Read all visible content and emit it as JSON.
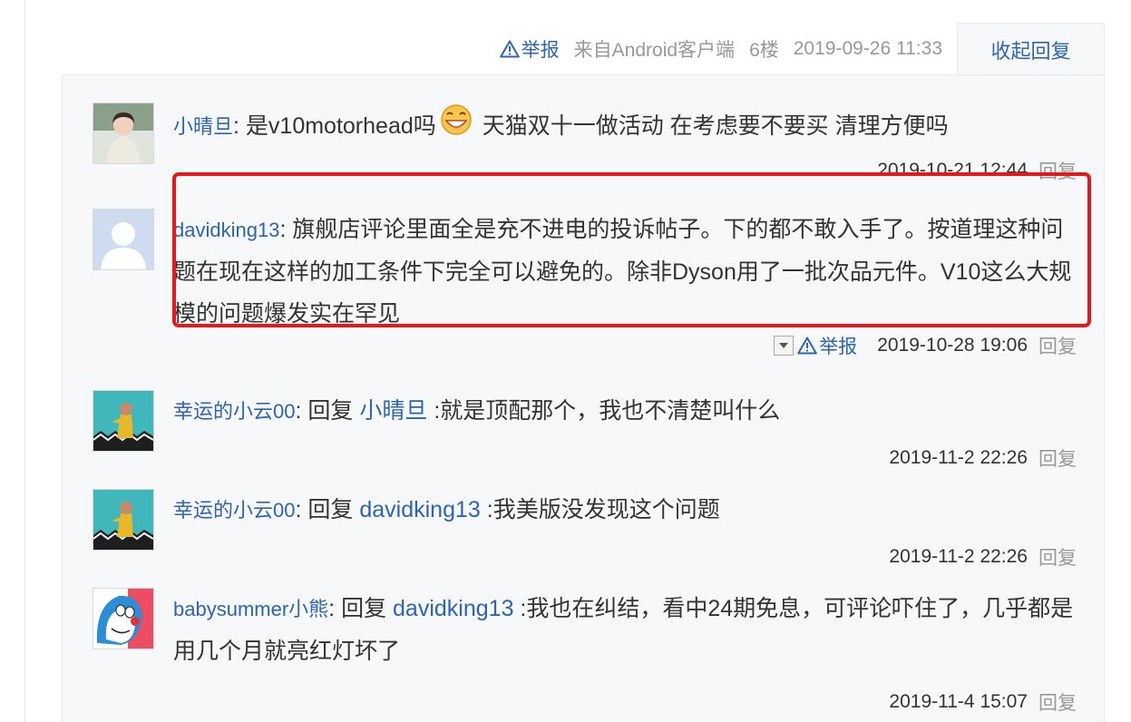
{
  "post_meta": {
    "report_label": "举报",
    "source": "来自Android客户端",
    "floor": "6楼",
    "time": "2019-09-26 11:33",
    "collapse_label": "收起回复"
  },
  "replies": [
    {
      "user": "小晴旦",
      "text_before": "是v10motorhead吗",
      "text_after": " 天猫双十一做活动 在考虑要不要买 清理方便吗",
      "time": "2019-10-21 12:44",
      "reply_label": "回复"
    },
    {
      "user": "davidking13",
      "text": "旗舰店评论里面全是充不进电的投诉帖子。下的都不敢入手了。按道理这种问题在现在这样的加工条件下完全可以避免的。除非Dyson用了一批次品元件。V10这么大规模的问题爆发实在罕见",
      "report_label": "举报",
      "time": "2019-10-28 19:06",
      "reply_label": "回复"
    },
    {
      "user": "幸运的小云00",
      "prefix": "回复",
      "ref_user": "小晴旦",
      "text": ":就是顶配那个，我也不清楚叫什么",
      "time": "2019-11-2 22:26",
      "reply_label": "回复"
    },
    {
      "user": "幸运的小云00",
      "prefix": "回复",
      "ref_user": "davidking13",
      "text": ":我美版没发现这个问题",
      "time": "2019-11-2 22:26",
      "reply_label": "回复"
    },
    {
      "user": "babysummer小熊",
      "prefix": "回复",
      "ref_user": "davidking13",
      "text": ":我也在纠结，看中24期免息，可评论吓住了，几乎都是用几个月就亮红灯坏了",
      "time": "2019-11-4 15:07",
      "reply_label": "回复"
    }
  ],
  "colors": {
    "link": "#2d64b3",
    "muted": "#999999",
    "panel_bg": "#f7f8fa",
    "highlight": "#e8181a"
  },
  "icons": {
    "report": "warning-triangle-icon",
    "emoji": "grinning-face-icon",
    "dropdown": "dropdown-arrow-icon"
  }
}
